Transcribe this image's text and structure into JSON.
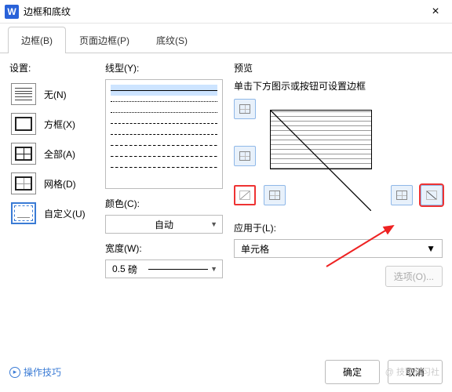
{
  "window": {
    "title": "边框和底纹",
    "close": "×"
  },
  "tabs": {
    "borders": "边框(B)",
    "page": "页面边框(P)",
    "shading": "底纹(S)"
  },
  "settings": {
    "label": "设置:",
    "none": "无(N)",
    "box": "方框(X)",
    "all": "全部(A)",
    "grid": "网格(D)",
    "custom": "自定义(U)"
  },
  "style": {
    "label": "线型(Y):"
  },
  "color": {
    "label": "颜色(C):",
    "value": "自动"
  },
  "width": {
    "label": "宽度(W):",
    "value": "0.5",
    "unit": "磅"
  },
  "preview": {
    "label": "预览",
    "hint": "单击下方图示或按钮可设置边框"
  },
  "apply": {
    "label": "应用于(L):",
    "value": "单元格"
  },
  "options": "选项(O)...",
  "tips": "操作技巧",
  "ok": "确定",
  "cancel": "取消",
  "watermark": "@ 技学研习社"
}
